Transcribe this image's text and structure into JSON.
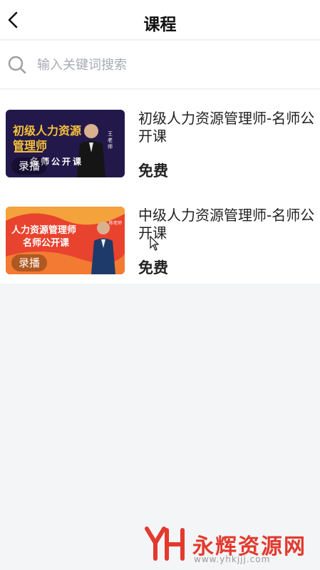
{
  "header": {
    "title": "课程"
  },
  "search": {
    "placeholder": "输入关键词搜索"
  },
  "courses": [
    {
      "title": "初级人力资源管理师-名师公开课",
      "price": "免费",
      "badge": "录播",
      "thumb": {
        "line1": "初级人力资源",
        "line2": "管理师",
        "line3": "名师公开课",
        "name": "王老师",
        "bg": "#1a1238",
        "accent": "#f6c23a"
      }
    },
    {
      "title": "中级人力资源管理师-名师公开课",
      "price": "免费",
      "badge": "录播",
      "thumb": {
        "line1": "人力资源管理师",
        "line2": "名师公开课",
        "name": "陈老师",
        "bg": "#e8432e",
        "accent": "#f4a23b"
      }
    }
  ],
  "watermark": {
    "brand": "永辉资源网",
    "url": "www.yhkjjj.com"
  }
}
